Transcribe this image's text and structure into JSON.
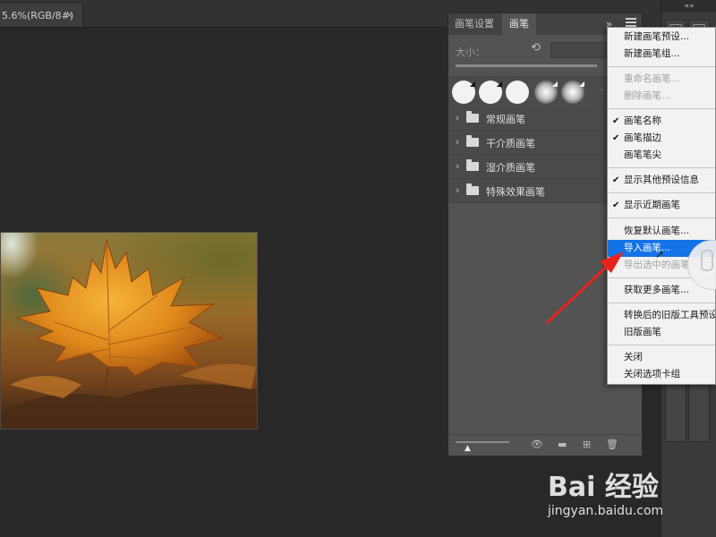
{
  "document": {
    "tab_title": "5.6%(RGB/8#)",
    "tab_close": "×"
  },
  "dock": {
    "collapse_icon": "««"
  },
  "brush_panel": {
    "tabs": [
      {
        "label": "画笔设置",
        "active": false
      },
      {
        "label": "画笔",
        "active": true
      }
    ],
    "expand_icon": "»",
    "size_label": "大小：",
    "reset_icon": "⟲",
    "groups": [
      {
        "label": "常规画笔"
      },
      {
        "label": "干介质画笔"
      },
      {
        "label": "湿介质画笔"
      },
      {
        "label": "特殊效果画笔"
      }
    ],
    "bottom": {
      "triangle": "▲",
      "eye_icon": "👁",
      "folder_icon": "▬",
      "new_icon": "⊞",
      "trash_icon": "🗑"
    }
  },
  "menu": {
    "items": [
      {
        "label": "新建画笔预设...",
        "checked": false,
        "disabled": false,
        "highlighted": false
      },
      {
        "label": "新建画笔组...",
        "checked": false,
        "disabled": false,
        "highlighted": false
      },
      {
        "label": "重命名画笔...",
        "checked": false,
        "disabled": true,
        "highlighted": false
      },
      {
        "label": "删除画笔...",
        "checked": false,
        "disabled": true,
        "highlighted": false
      },
      {
        "label": "画笔名称",
        "checked": true,
        "disabled": false,
        "highlighted": false
      },
      {
        "label": "画笔描边",
        "checked": true,
        "disabled": false,
        "highlighted": false
      },
      {
        "label": "画笔笔尖",
        "checked": false,
        "disabled": false,
        "highlighted": false
      },
      {
        "label": "显示其他预设信息",
        "checked": true,
        "disabled": false,
        "highlighted": false
      },
      {
        "label": "显示近期画笔",
        "checked": true,
        "disabled": false,
        "highlighted": false
      },
      {
        "label": "恢复默认画笔...",
        "checked": false,
        "disabled": false,
        "highlighted": false
      },
      {
        "label": "导入画笔...",
        "checked": false,
        "disabled": false,
        "highlighted": true
      },
      {
        "label": "导出选中的画笔...",
        "checked": false,
        "disabled": true,
        "highlighted": false
      },
      {
        "label": "获取更多画笔...",
        "checked": false,
        "disabled": false,
        "highlighted": false
      },
      {
        "label": "转换后的旧版工具预设",
        "checked": false,
        "disabled": false,
        "highlighted": false
      },
      {
        "label": "旧版画笔",
        "checked": false,
        "disabled": false,
        "highlighted": false
      },
      {
        "label": "关闭",
        "checked": false,
        "disabled": false,
        "highlighted": false
      },
      {
        "label": "关闭选项卡组",
        "checked": false,
        "disabled": false,
        "highlighted": false
      }
    ],
    "check_mark": "✔",
    "accent_color": "#1473e6"
  },
  "annotation": {
    "arrow_color": "#e8231e"
  },
  "watermark": {
    "logo": "Bai 经验",
    "url": "jingyan.baidu.com"
  }
}
